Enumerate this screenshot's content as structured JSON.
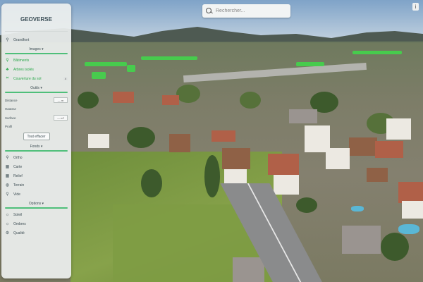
{
  "app": {
    "title": "GEOVERSE"
  },
  "search": {
    "placeholder": "Rechercher..."
  },
  "top_right": {
    "icon": "info-icon",
    "glyph": "ⅰ"
  },
  "sidebar": {
    "location": {
      "label": "Grandfont",
      "icon": "pin-icon"
    },
    "sections": {
      "images": {
        "title": "Images ▾"
      },
      "outils": {
        "title": "Outils ▾"
      },
      "fonds": {
        "title": "Fonds ▾"
      },
      "options": {
        "title": "Options ▾"
      }
    },
    "images_items": [
      {
        "label": "Bâtiments",
        "icon": "pin-icon",
        "active": true
      },
      {
        "label": "Arbres isolés",
        "icon": "tree-icon",
        "active": true
      },
      {
        "label": "Couverture du sol",
        "icon": "layers-icon",
        "active": true,
        "badge": "4"
      }
    ],
    "tools": [
      {
        "label": "Distance",
        "value": "— m"
      },
      {
        "label": "Hauteur",
        "value": ""
      },
      {
        "label": "Surface",
        "value": "— m²"
      },
      {
        "label": "Profil",
        "value": ""
      }
    ],
    "tools_button": "Tout effacer",
    "fonds_items": [
      {
        "label": "Ortho",
        "icon": "pin-icon"
      },
      {
        "label": "Carte",
        "icon": "grid-icon"
      },
      {
        "label": "Relief",
        "icon": "grid-icon"
      },
      {
        "label": "Terrain",
        "icon": "globe-icon"
      },
      {
        "label": "Vide",
        "icon": "pin-icon"
      }
    ],
    "options_items": [
      {
        "label": "Soleil",
        "icon": "sun-icon"
      },
      {
        "label": "Ombres",
        "icon": "sun-icon"
      },
      {
        "label": "Qualité",
        "icon": "gear-icon"
      }
    ]
  }
}
